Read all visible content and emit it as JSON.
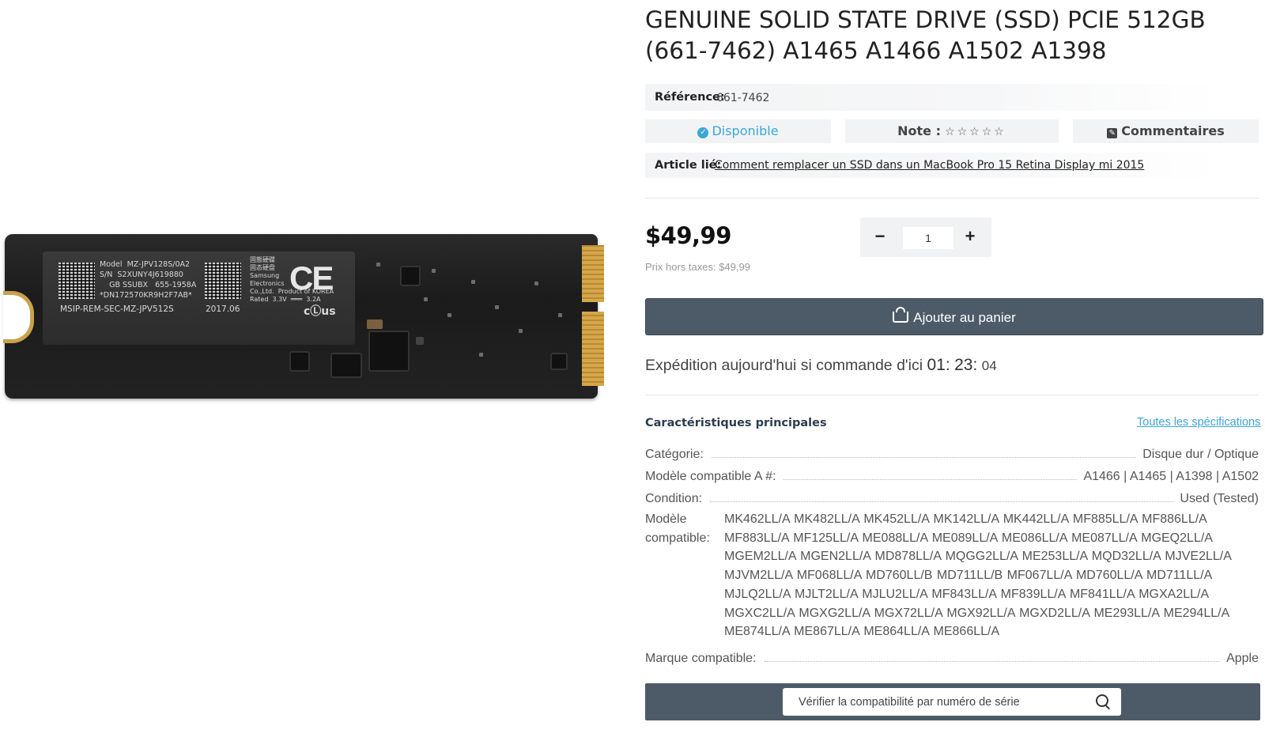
{
  "product": {
    "title": "GENUINE SOLID STATE DRIVE (SSD) PCIE 512GB (661-7462) A1465 A1466 A1502 A1398",
    "image_alt": "SSD PCIe 512GB",
    "sticker": {
      "line1": "Model  MZ-JPV128S/0A2",
      "line2": "S/N  S2XUNY4J619880",
      "line3": "    GB SSUBX   655-1958A",
      "line4": "*DN172570KR9H2F7AB*",
      "line5": "MSIP-REM-SEC-MZ-JPV512S",
      "date": "2017.06",
      "maker": "固態硬碟\n固态硬盘\nSamsung\nElectronics\nCo.,Ltd.  Product of KOREA\nRated  3.3V  ═══  3.2A",
      "ce": "CE",
      "ul": "cⓁus"
    }
  },
  "reference": {
    "label": "Référence:",
    "value": "661-7462"
  },
  "availability": {
    "label": "Disponible",
    "check_glyph": "✓"
  },
  "rating": {
    "label": "Note :",
    "stars": "☆☆☆☆☆"
  },
  "comments": {
    "label": "Commentaires",
    "icon_glyph": "✎"
  },
  "related_article": {
    "label": "Article lié:",
    "link_text": "Comment remplacer un SSD dans un MacBook Pro 15 Retina Display mi 2015"
  },
  "price": {
    "value": "$49,99",
    "excl_tax": "Prix hors taxes: $49,99"
  },
  "quantity": {
    "minus": "−",
    "value": "1",
    "plus": "+"
  },
  "cart": {
    "label": "Ajouter au panier"
  },
  "shipping": {
    "text": "Expédition aujourd'hui si commande d'ici",
    "hours": "01",
    "minutes": "23",
    "seconds": "04"
  },
  "specs": {
    "title": "Caractéristiques principales",
    "all_link": "Toutes les spécifications",
    "category_key": "Catégorie:",
    "category_val": "Disque dur / Optique",
    "model_a_key": "Modèle compatible A #:",
    "model_a_val": "A1466 | A1465 | A1398 | A1502",
    "condition_key": "Condition:",
    "condition_val": "Used (Tested)",
    "compat_key": "Modèle compatible:",
    "compat_val": "MK462LL/A MK482LL/A MK452LL/A MK142LL/A MK442LL/A MF885LL/A MF886LL/A MF883LL/A MF125LL/A ME088LL/A ME089LL/A ME086LL/A ME087LL/A MGEQ2LL/A MGEM2LL/A MGEN2LL/A MD878LL/A MQGG2LL/A ME253LL/A MQD32LL/A MJVE2LL/A MJVM2LL/A MF068LL/A MD760LL/B MD711LL/B MF067LL/A MD760LL/A MD711LL/A MJLQ2LL/A MJLT2LL/A MJLU2LL/A MF843LL/A MF839LL/A MF841LL/A MGXA2LL/A MGXC2LL/A MGXG2LL/A MGX72LL/A MGX92LL/A MGXD2LL/A ME293LL/A ME294LL/A ME874LL/A ME867LL/A ME864LL/A ME866LL/A",
    "brand_key": "Marque compatible:",
    "brand_val": "Apple"
  },
  "serial_check": {
    "placeholder": "Vérifier la compatibilité par numéro de série"
  }
}
